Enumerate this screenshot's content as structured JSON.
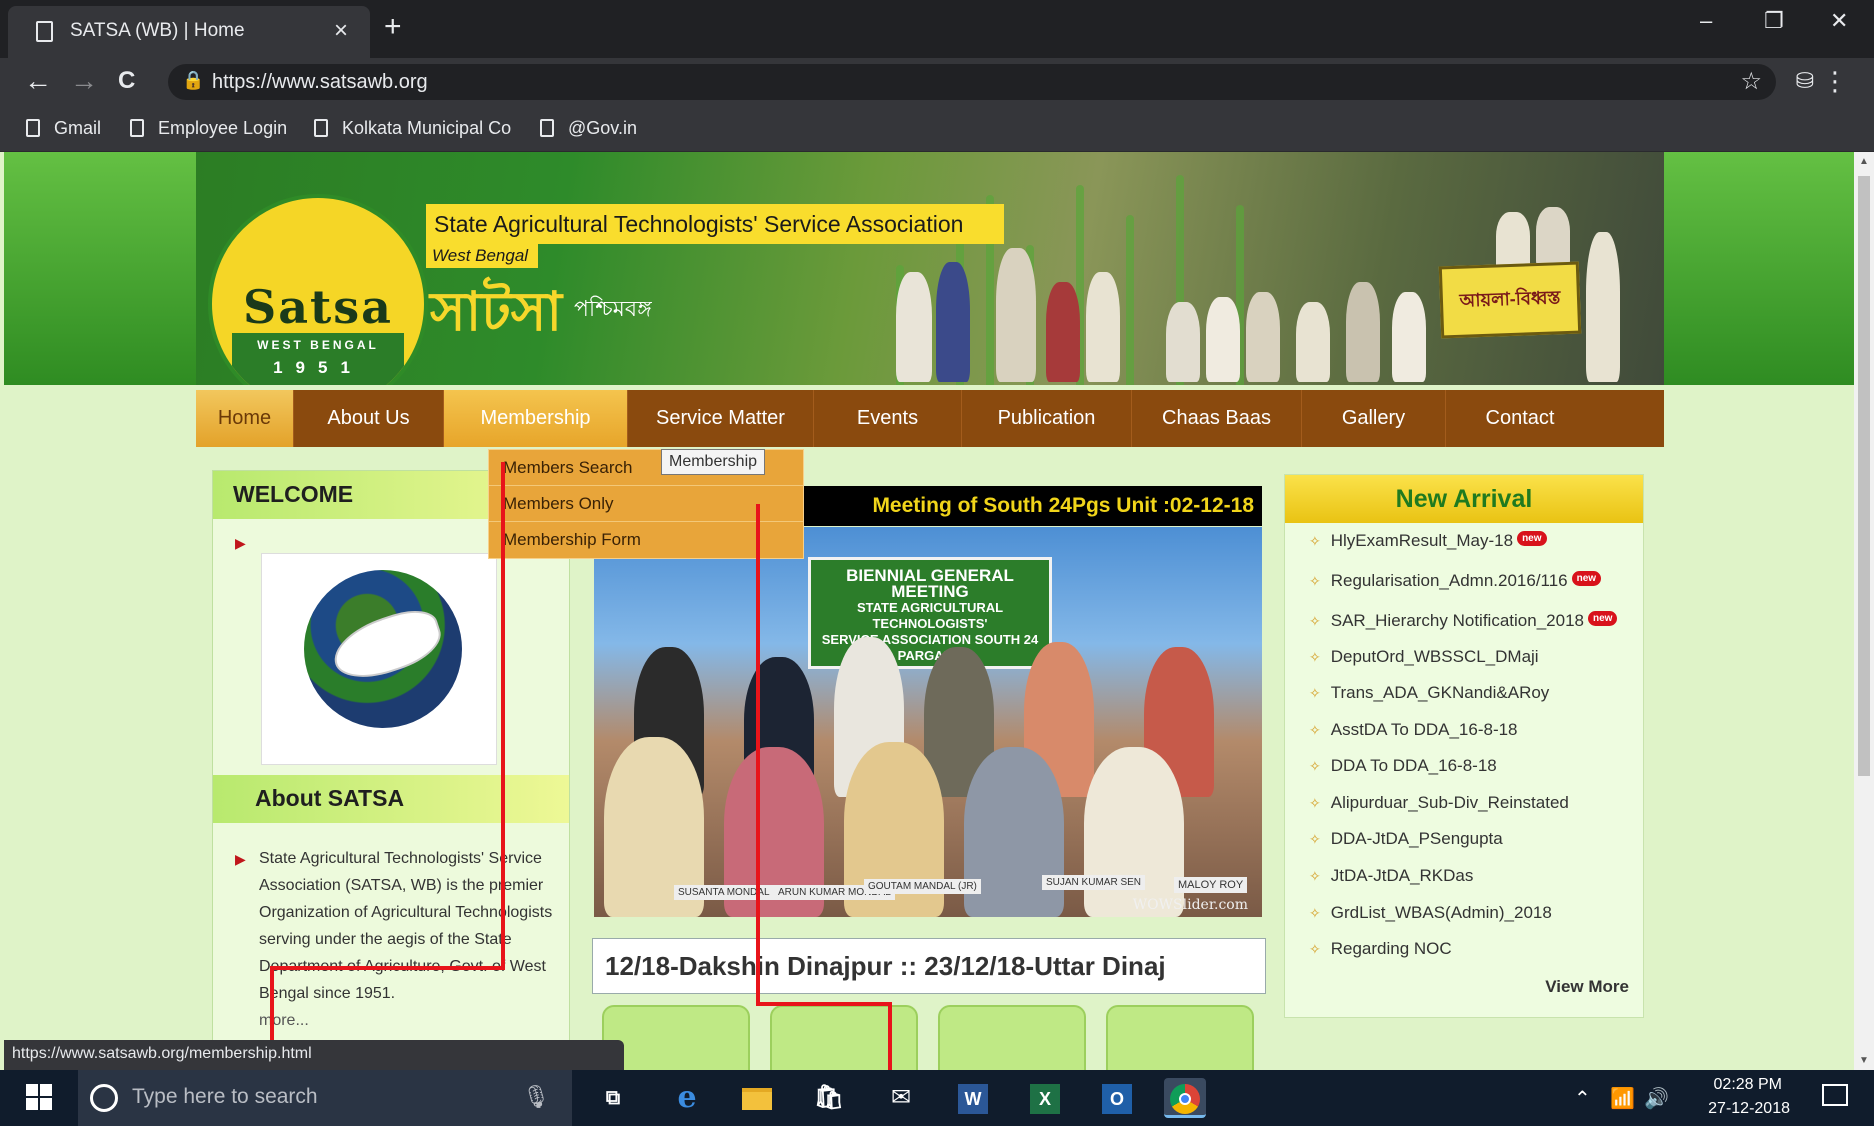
{
  "browser": {
    "tab_title": "SATSA (WB) | Home",
    "tab_close": "×",
    "new_tab": "+",
    "url": "https://www.satsawb.org",
    "status_url": "https://www.satsawb.org/membership.html",
    "win_min": "–",
    "win_restore": "❐",
    "win_close": "✕",
    "back": "←",
    "forward": "→",
    "reload": "C",
    "star": "☆",
    "menu": "⋮",
    "bookmarks": [
      "Gmail",
      "Employee Login",
      "Kolkata Municipal Co",
      "@Gov.in"
    ]
  },
  "header": {
    "org_name": "State Agricultural Technologists' Service Association",
    "org_sub": "West Bengal",
    "logo_text": "Satsa",
    "logo_region": "WEST BENGAL",
    "logo_year": "1951",
    "bengali_name": "সাটসা",
    "bengali_sub": "পশ্চিমবঙ্গ",
    "banner_sign": "আয়লা-বিধ্বস্ত"
  },
  "nav": {
    "items": [
      "Home",
      "About Us",
      "Membership",
      "Service Matter",
      "Events",
      "Publication",
      "Chaas Baas",
      "Gallery",
      "Contact"
    ],
    "active": "Membership"
  },
  "dropdown": {
    "items": [
      "Members Search",
      "Members Only",
      "Membership Form"
    ],
    "tooltip": "Membership"
  },
  "welcome": {
    "heading": "WELCOME",
    "about_heading": "About SATSA",
    "about_text": "State Agricultural Technologists' Service Association (SATSA, WB) is the premier Organization of Agricultural Technologists serving under the aegis of the State Department of Agriculture, Govt. of West Bengal since 1951.",
    "more": "more..."
  },
  "slider": {
    "title": "Meeting of South 24Pgs Unit :02-12-18",
    "banner_line1": "BIENNIAL GENERAL MEETING",
    "banner_line2": "STATE AGRICULTURAL TECHNOLOGISTS'",
    "banner_line3": "SERVICE ASSOCIATION SOUTH 24 PARGANA",
    "watermark": "WOWSlider.com",
    "name_tags": [
      "SUSANTA MONDAL",
      "ARUN KUMAR MONDAL",
      "GOUTAM MANDAL (JR)",
      "SUJAN KUMAR SEN",
      "MALOY ROY"
    ],
    "ticker": "12/18-Dakshin Dinajpur ::          23/12/18-Uttar Dinaj"
  },
  "new_arrival": {
    "heading": "New Arrival",
    "items": [
      "HlyExamResult_May-18",
      "Regularisation_Admn.2016/116",
      "SAR_Hierarchy Notification_2018",
      "DeputOrd_WBSSCL_DMaji",
      "Trans_ADA_GKNandi&ARoy",
      "AsstDA To DDA_16-8-18",
      "DDA To DDA_16-8-18",
      "Alipurduar_Sub-Div_Reinstated",
      "DDA-JtDA_PSengupta",
      "JtDA-JtDA_RKDas",
      "GrdList_WBAS(Admin)_2018",
      "Regarding NOC"
    ],
    "new_badge": "new",
    "view_more": "View More"
  },
  "taskbar": {
    "search_placeholder": "Type here to search",
    "time": "02:28 PM",
    "date": "27-12-2018",
    "apps": [
      "task-view-icon",
      "edge-icon",
      "file-explorer-icon",
      "store-icon",
      "mail-icon",
      "word-icon",
      "excel-icon",
      "outlook-icon",
      "chrome-icon"
    ]
  },
  "colors": {
    "nav_brown": "#8a4a0e",
    "nav_active": "#e7a52a",
    "page_bg": "#dff3c8",
    "annotation_red": "#e8141a"
  }
}
